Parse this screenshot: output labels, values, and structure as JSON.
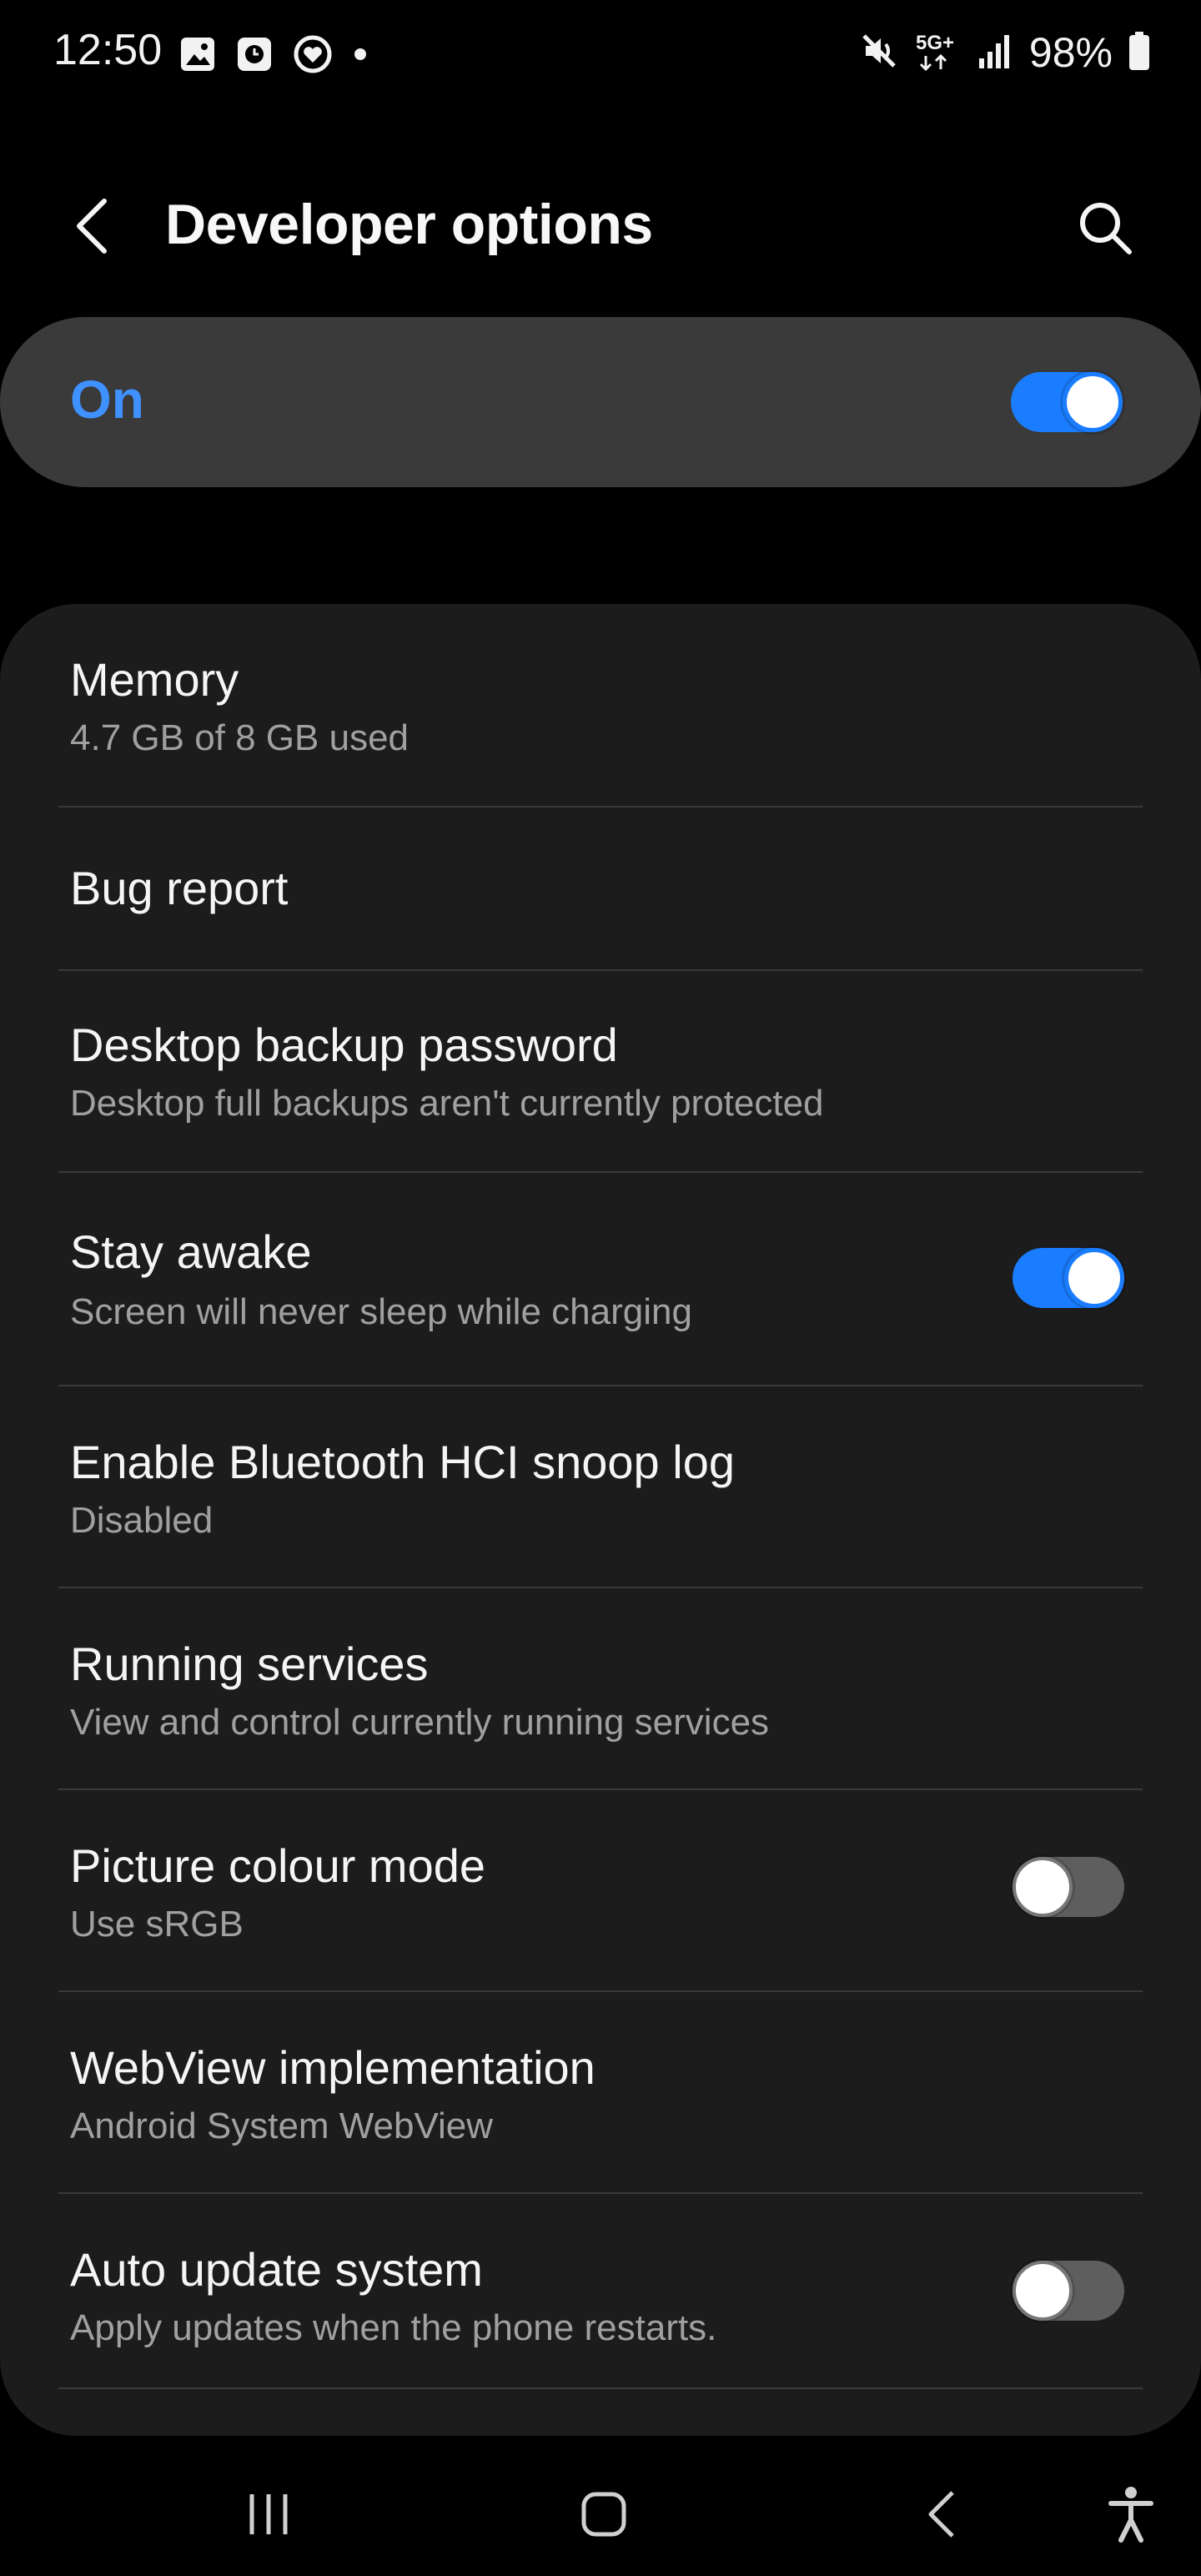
{
  "status_bar": {
    "time": "12:50",
    "battery": "98%",
    "network_badge": "5G+",
    "left_icons": [
      "gallery-icon",
      "clock-icon",
      "heart-icon",
      "dot-icon"
    ],
    "right_icons": [
      "mute-icon",
      "5g-icon",
      "signal-icon",
      "battery-icon"
    ]
  },
  "header": {
    "title": "Developer options"
  },
  "master_switch": {
    "label": "On",
    "state": true
  },
  "settings": [
    {
      "title": "Memory",
      "subtitle": "4.7 GB of 8 GB used"
    },
    {
      "title": "Bug report"
    },
    {
      "title": "Desktop backup password",
      "subtitle": "Desktop full backups aren't currently protected"
    },
    {
      "title": "Stay awake",
      "subtitle": "Screen will never sleep while charging",
      "toggle": true
    },
    {
      "title": "Enable Bluetooth HCI snoop log",
      "subtitle": "Disabled"
    },
    {
      "title": "Running services",
      "subtitle": "View and control currently running services"
    },
    {
      "title": "Picture colour mode",
      "subtitle": "Use sRGB",
      "toggle": false
    },
    {
      "title": "WebView implementation",
      "subtitle": "Android System WebView"
    },
    {
      "title": "Auto update system",
      "subtitle": "Apply updates when the phone restarts.",
      "toggle": false
    }
  ],
  "colors": {
    "accent": "#1a7cff",
    "label_accent": "#3e91ff",
    "card_bg": "#1c1c1c",
    "master_bg": "#3a3a3a"
  },
  "nav_bar": {
    "buttons": [
      "recent-apps-icon",
      "home-icon",
      "back-icon",
      "accessibility-icon"
    ]
  }
}
